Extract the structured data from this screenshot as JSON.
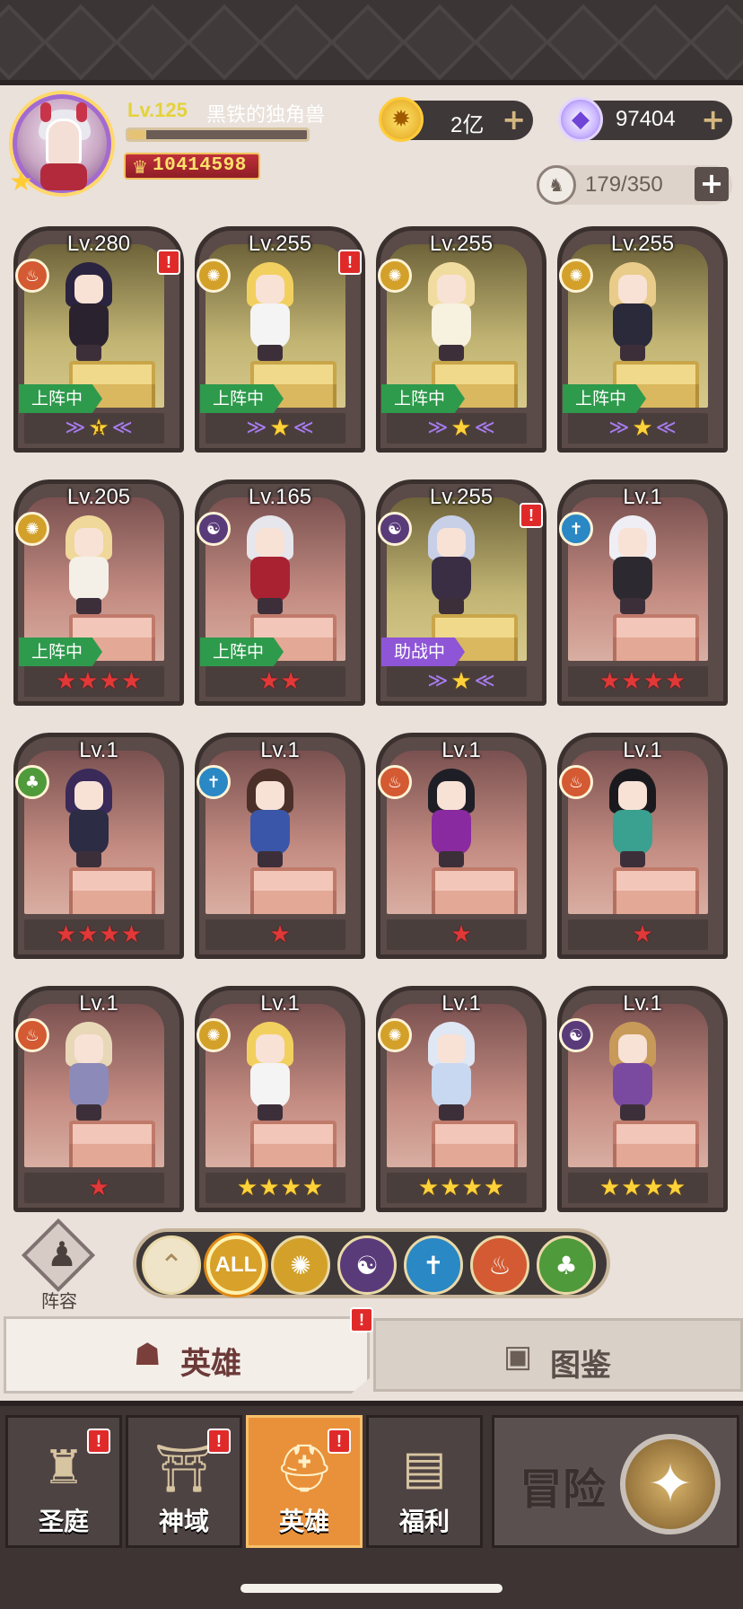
{
  "player": {
    "level_label": "Lv.125",
    "name": "黑铁的独角兽",
    "xp_fraction": 0.1,
    "power": "10414598"
  },
  "currency": {
    "gold": "2亿",
    "gems": "97404",
    "capacity": "179/350"
  },
  "heroes": [
    {
      "level": "Lv.280",
      "element": "fire",
      "bg": "gold",
      "status": "上阵中",
      "alert": true,
      "rank_type": "wing",
      "rank_count": 1,
      "wing_label": "1",
      "colors": [
        "#2a2440",
        "#2b2230"
      ]
    },
    {
      "level": "Lv.255",
      "element": "light",
      "bg": "gold",
      "status": "上阵中",
      "alert": true,
      "rank_type": "wing",
      "rank_count": 1,
      "colors": [
        "#f2d060",
        "#f4f4f4"
      ]
    },
    {
      "level": "Lv.255",
      "element": "light",
      "bg": "gold",
      "status": "上阵中",
      "alert": false,
      "rank_type": "wing",
      "rank_count": 1,
      "colors": [
        "#f1dca0",
        "#f7f1e0"
      ]
    },
    {
      "level": "Lv.255",
      "element": "light",
      "bg": "gold",
      "status": "上阵中",
      "alert": false,
      "rank_type": "wing",
      "rank_count": 1,
      "colors": [
        "#e9cc8a",
        "#2a2a3a"
      ]
    },
    {
      "level": "Lv.205",
      "element": "light",
      "bg": "red",
      "status": "上阵中",
      "alert": false,
      "rank_type": "red",
      "rank_count": 4,
      "colors": [
        "#f0d79a",
        "#f4f0e8"
      ]
    },
    {
      "level": "Lv.165",
      "element": "dark",
      "bg": "red",
      "status": "上阵中",
      "alert": false,
      "rank_type": "red",
      "rank_count": 2,
      "colors": [
        "#e6e6ec",
        "#a82232"
      ]
    },
    {
      "level": "Lv.255",
      "element": "dark",
      "bg": "gold",
      "status": "助战中",
      "alert": true,
      "rank_type": "wing",
      "rank_count": 1,
      "colors": [
        "#c8d0e8",
        "#3a2e44"
      ]
    },
    {
      "level": "Lv.1",
      "element": "holy",
      "bg": "red",
      "status": "",
      "alert": false,
      "rank_type": "red",
      "rank_count": 4,
      "colors": [
        "#eeeef4",
        "#2c2a30"
      ]
    },
    {
      "level": "Lv.1",
      "element": "nature",
      "bg": "red",
      "status": "",
      "alert": false,
      "rank_type": "red",
      "rank_count": 4,
      "colors": [
        "#3a2a5a",
        "#2c2c44"
      ]
    },
    {
      "level": "Lv.1",
      "element": "holy",
      "bg": "red",
      "status": "",
      "alert": false,
      "rank_type": "red",
      "rank_count": 1,
      "colors": [
        "#4a3028",
        "#3a56a8"
      ]
    },
    {
      "level": "Lv.1",
      "element": "fire",
      "bg": "red",
      "status": "",
      "alert": false,
      "rank_type": "red",
      "rank_count": 1,
      "colors": [
        "#1e1e26",
        "#8a2aa0"
      ]
    },
    {
      "level": "Lv.1",
      "element": "fire",
      "bg": "red",
      "status": "",
      "alert": false,
      "rank_type": "red",
      "rank_count": 1,
      "colors": [
        "#1a1a1e",
        "#3aa090"
      ]
    },
    {
      "level": "Lv.1",
      "element": "fire",
      "bg": "red",
      "status": "",
      "alert": false,
      "rank_type": "red",
      "rank_count": 1,
      "colors": [
        "#e8d8b8",
        "#8c8ab8"
      ]
    },
    {
      "level": "Lv.1",
      "element": "light",
      "bg": "red",
      "status": "",
      "alert": false,
      "rank_type": "gold",
      "rank_count": 4,
      "colors": [
        "#f2d060",
        "#f4f4f4"
      ]
    },
    {
      "level": "Lv.1",
      "element": "light",
      "bg": "red",
      "status": "",
      "alert": false,
      "rank_type": "gold",
      "rank_count": 4,
      "colors": [
        "#dfe6f4",
        "#c8d8f0"
      ]
    },
    {
      "level": "Lv.1",
      "element": "dark",
      "bg": "red",
      "status": "",
      "alert": false,
      "rank_type": "gold",
      "rank_count": 4,
      "colors": [
        "#c89a5a",
        "#7a4aa0"
      ]
    }
  ],
  "filters": {
    "lineup_label": "阵容",
    "all_label": "ALL",
    "elements": [
      "light",
      "dark",
      "holy",
      "fire",
      "nature"
    ]
  },
  "tabs": {
    "hero": "英雄",
    "codex": "图鉴"
  },
  "nav": {
    "items": [
      {
        "label": "圣庭",
        "alert": true
      },
      {
        "label": "神域",
        "alert": true
      },
      {
        "label": "英雄",
        "alert": true,
        "active": true
      },
      {
        "label": "福利",
        "alert": false
      }
    ],
    "adventure": "冒险"
  },
  "alert_mark": "!",
  "colors": {
    "fire": "#d35a32",
    "light": "#d3a12a",
    "dark": "#5a3b7a",
    "holy": "#2a88c4",
    "nature": "#4f9a3a",
    "deployed_tag": "#2e9a4c",
    "support_tag": "#8e55d6"
  }
}
